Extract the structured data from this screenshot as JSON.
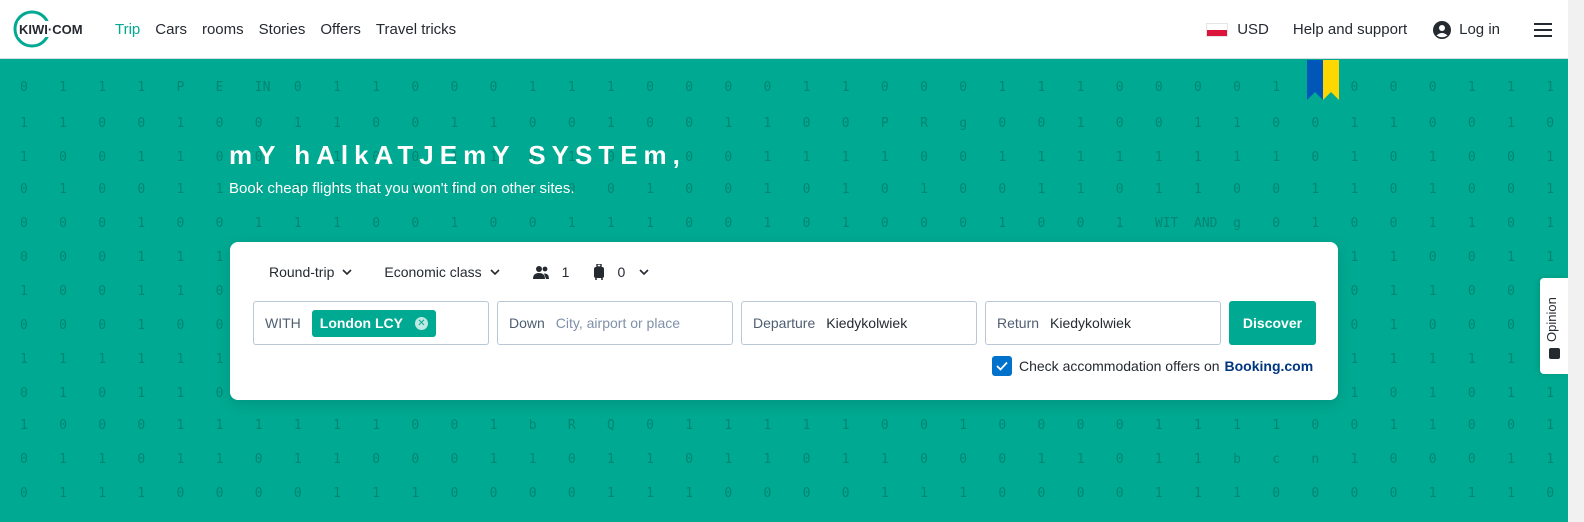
{
  "header": {
    "logo_text": "KIWI·COM",
    "nav": [
      {
        "label": "Trip",
        "active": true
      },
      {
        "label": "Cars"
      },
      {
        "label": "rooms"
      },
      {
        "label": "Stories"
      },
      {
        "label": "Offers"
      },
      {
        "label": "Travel tricks"
      }
    ],
    "currency": "USD",
    "help": "Help and support",
    "login": "Log in"
  },
  "hero": {
    "title": "mY hAlkATJEmY SYSTEm,",
    "subtitle": "Book cheap flights that you won't find on other sites."
  },
  "search": {
    "trip_type": "Round-trip",
    "cabin_class": "Economic class",
    "passengers": "1",
    "bags": "0",
    "from_label": "WITH",
    "from_chip": "London LCY",
    "to_label": "Down",
    "to_placeholder": "City, airport or place",
    "departure_label": "Departure",
    "departure_value": "Kiedykolwiek",
    "return_label": "Return",
    "return_value": "Kiedykolwiek",
    "discover_label": "Discover",
    "booking_text": "Check accommodation offers on",
    "booking_brand": "Booking.com"
  },
  "opinion_label": "Opinion",
  "colors": {
    "brand": "#00a991",
    "checkbox": "#0172cb",
    "booking": "#003580"
  }
}
